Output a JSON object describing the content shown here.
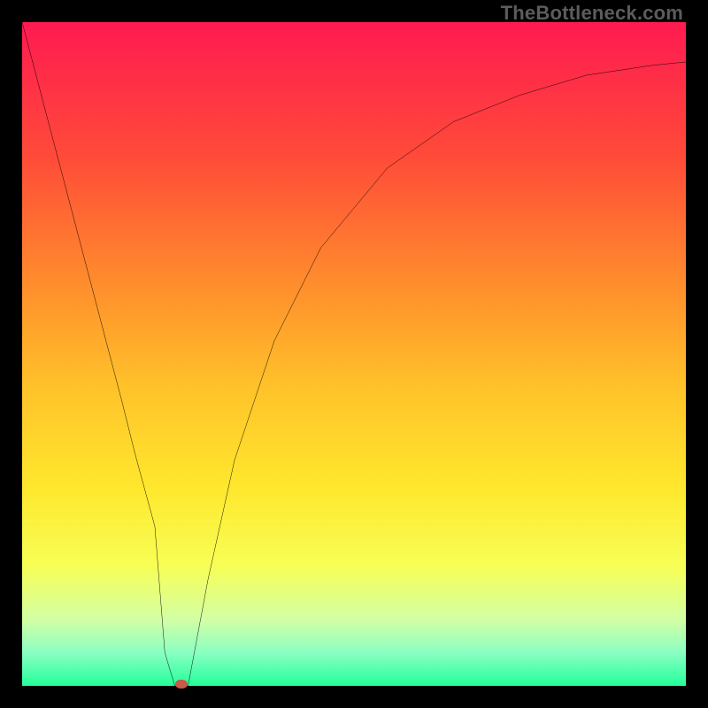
{
  "watermark": "TheBottleneck.com",
  "chart_data": {
    "type": "line",
    "title": "",
    "xlabel": "",
    "ylabel": "",
    "xlim": [
      0,
      100
    ],
    "ylim": [
      0,
      100
    ],
    "grid": false,
    "axes_visible": false,
    "background_gradient": {
      "stops": [
        {
          "pos": 0.0,
          "color": "#ff1a51"
        },
        {
          "pos": 0.2,
          "color": "#ff4a39"
        },
        {
          "pos": 0.4,
          "color": "#ff8f2c"
        },
        {
          "pos": 0.55,
          "color": "#ffc22a"
        },
        {
          "pos": 0.7,
          "color": "#ffe72d"
        },
        {
          "pos": 0.82,
          "color": "#f7ff56"
        },
        {
          "pos": 0.9,
          "color": "#d3ffa4"
        },
        {
          "pos": 0.95,
          "color": "#8affc2"
        },
        {
          "pos": 1.0,
          "color": "#23ff9a"
        }
      ]
    },
    "series": [
      {
        "name": "bottleneck-curve",
        "x": [
          0,
          5,
          10,
          15,
          17,
          20,
          21.5,
          23,
          25,
          28,
          32,
          38,
          45,
          55,
          65,
          75,
          85,
          95,
          100
        ],
        "y": [
          100,
          81,
          62,
          43,
          35,
          24,
          5,
          0,
          0,
          16,
          34,
          52,
          66,
          78,
          85,
          89,
          92,
          93.5,
          94
        ]
      }
    ],
    "markers": [
      {
        "name": "optimum-marker",
        "x": 24,
        "y": 0.3,
        "color": "#c85a4a"
      }
    ],
    "annotations": []
  }
}
